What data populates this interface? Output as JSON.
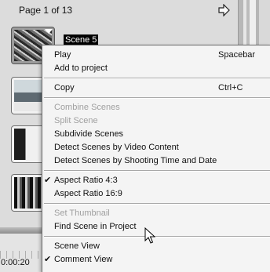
{
  "header": {
    "page_label": "Page 1 of 13"
  },
  "icons": {
    "next_page": "arrow-right-icon",
    "cursor": "mouse-pointer-icon"
  },
  "selected_scene": {
    "name": "Scene 5"
  },
  "timeline": {
    "time": "0:00:20"
  },
  "context_menu": {
    "play": {
      "label": "Play",
      "shortcut": "Spacebar"
    },
    "add_to_project": {
      "label": "Add to project"
    },
    "copy": {
      "label": "Copy",
      "shortcut": "Ctrl+C"
    },
    "combine_scenes": {
      "label": "Combine Scenes"
    },
    "split_scene": {
      "label": "Split Scene"
    },
    "subdivide_scenes": {
      "label": "Subdivide Scenes"
    },
    "detect_by_content": {
      "label": "Detect Scenes by Video Content"
    },
    "detect_by_time": {
      "label": "Detect Scenes by Shooting Time and Date"
    },
    "aspect_43": {
      "label": "Aspect Ratio 4:3",
      "checked": true
    },
    "aspect_169": {
      "label": "Aspect Ratio 16:9",
      "checked": false
    },
    "set_thumbnail": {
      "label": "Set Thumbnail"
    },
    "find_scene": {
      "label": "Find Scene in Project"
    },
    "scene_view": {
      "label": "Scene View",
      "checked": false
    },
    "comment_view": {
      "label": "Comment View",
      "checked": true
    },
    "check_glyph": "✔"
  }
}
